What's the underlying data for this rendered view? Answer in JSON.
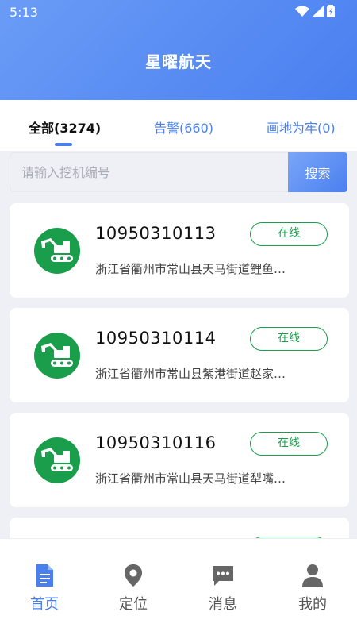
{
  "status_bar": {
    "time": "5:13"
  },
  "header": {
    "title": "星曜航天"
  },
  "tabs": [
    {
      "label": "全部(3274)"
    },
    {
      "label": "告警(660)"
    },
    {
      "label": "画地为牢(0)"
    }
  ],
  "search": {
    "placeholder": "请输入挖机编号",
    "button_label": "搜索"
  },
  "cards": [
    {
      "id": "10950310113",
      "status": "在线",
      "address": "浙江省衢州市常山县天马街道鲤鱼…"
    },
    {
      "id": "10950310114",
      "status": "在线",
      "address": "浙江省衢州市常山县紫港街道赵家…"
    },
    {
      "id": "10950310116",
      "status": "在线",
      "address": "浙江省衢州市常山县天马街道犁嘴…"
    },
    {
      "id": "",
      "status": "",
      "address": ""
    }
  ],
  "nav": [
    {
      "label": "首页",
      "icon": "document-icon"
    },
    {
      "label": "定位",
      "icon": "location-pin-icon"
    },
    {
      "label": "消息",
      "icon": "message-icon"
    },
    {
      "label": "我的",
      "icon": "person-icon"
    }
  ],
  "colors": {
    "accent": "#4a7ff0",
    "online": "#1a9e4b"
  }
}
